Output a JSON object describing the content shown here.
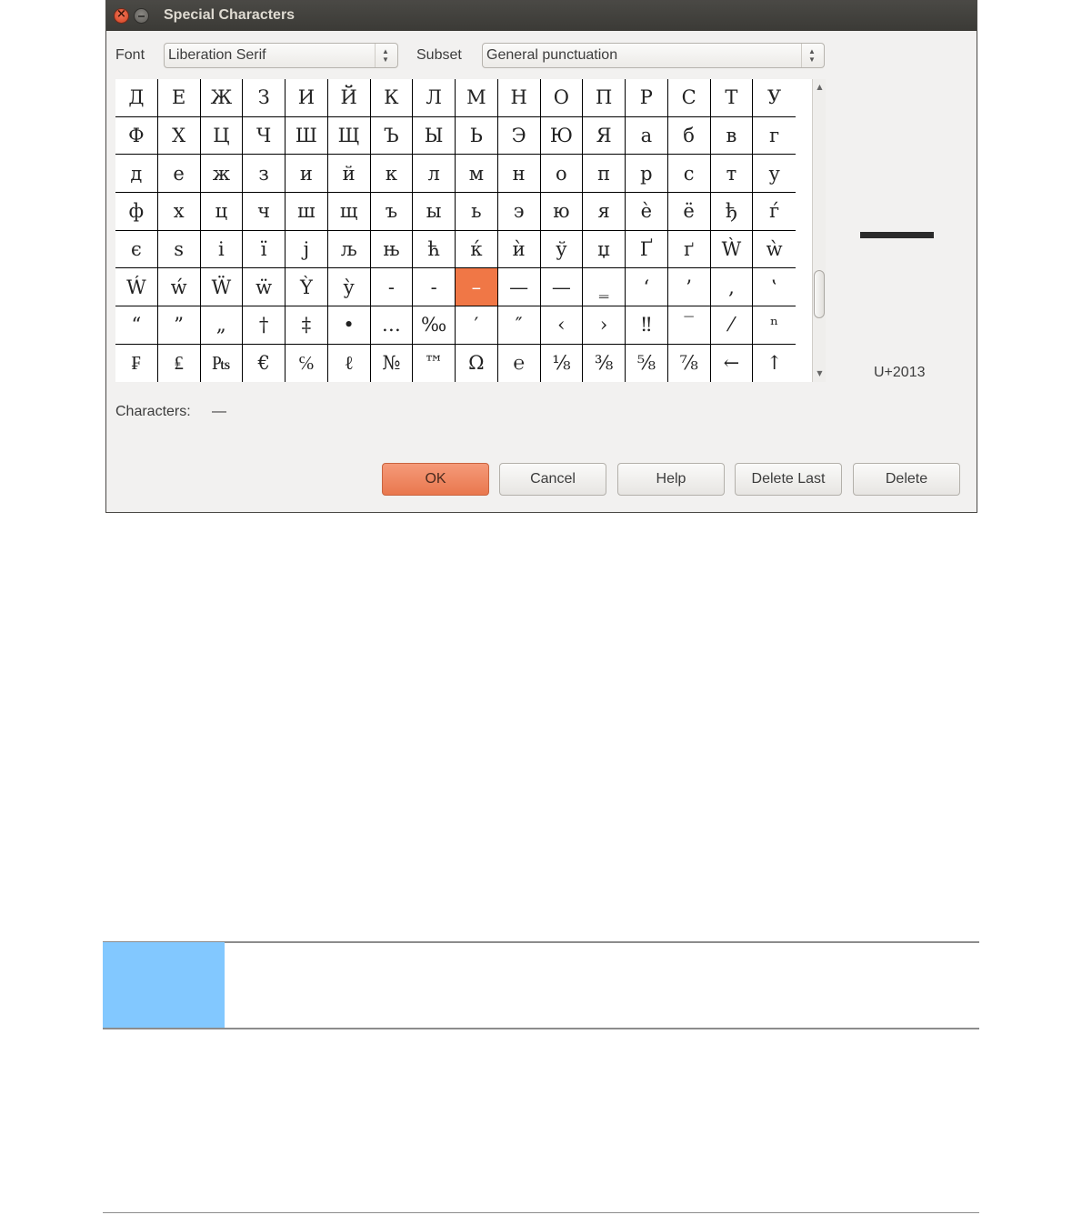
{
  "dialog": {
    "title": "Special Characters",
    "font_label": "Font",
    "font_value": "Liberation Serif",
    "subset_label": "Subset",
    "subset_value": "General punctuation",
    "characters_label": "Characters:",
    "characters_value": "—",
    "unicode_label": "U+2013",
    "selected_index": 88,
    "cells": [
      "Д",
      "Е",
      "Ж",
      "З",
      "И",
      "Й",
      "К",
      "Л",
      "М",
      "Н",
      "О",
      "П",
      "Р",
      "С",
      "Т",
      "У",
      "Ф",
      "Х",
      "Ц",
      "Ч",
      "Ш",
      "Щ",
      "Ъ",
      "Ы",
      "Ь",
      "Э",
      "Ю",
      "Я",
      "а",
      "б",
      "в",
      "г",
      "д",
      "е",
      "ж",
      "з",
      "и",
      "й",
      "к",
      "л",
      "м",
      "н",
      "о",
      "п",
      "р",
      "с",
      "т",
      "у",
      "ф",
      "х",
      "ц",
      "ч",
      "ш",
      "щ",
      "ъ",
      "ы",
      "ь",
      "э",
      "ю",
      "я",
      "è",
      "ё",
      "ђ",
      "ѓ",
      "є",
      "s",
      "i",
      "ї",
      "j",
      "љ",
      "њ",
      "ћ",
      "ќ",
      "ѝ",
      "ў",
      "џ",
      "Ґ",
      "ґ",
      "Ẁ",
      "ẁ",
      "Ẃ",
      "ẃ",
      "Ẅ",
      "ẅ",
      "Ỳ",
      "ỳ",
      "-",
      "-",
      "–",
      "—",
      "—",
      "‗",
      "‘",
      "’",
      "‚",
      "‛",
      "“",
      "”",
      "„",
      "†",
      "‡",
      "•",
      "…",
      "‰",
      "′",
      "″",
      "‹",
      "›",
      "‼",
      "‾",
      "⁄",
      "ⁿ",
      "₣",
      "₤",
      "₧",
      "€",
      "℅",
      "ℓ",
      "№",
      "™",
      "Ω",
      "℮",
      "⅛",
      "⅜",
      "⅝",
      "⅞",
      "←",
      "↑"
    ],
    "buttons": {
      "ok": "OK",
      "cancel": "Cancel",
      "help": "Help",
      "delete_last": "Delete Last",
      "delete": "Delete"
    }
  }
}
